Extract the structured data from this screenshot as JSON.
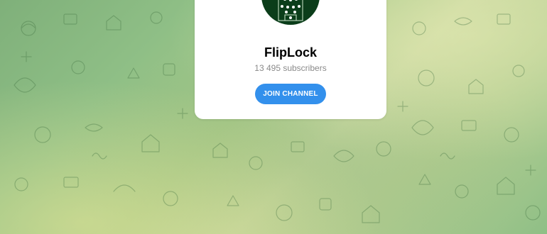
{
  "channel": {
    "name": "FlipLock",
    "subscribers": "13 495 subscribers",
    "join_label": "JOIN CHANNEL",
    "avatar_icon": "football-pitch-lineup-icon"
  },
  "colors": {
    "accent": "#3390ec",
    "avatar_bg": "#0b3d1a",
    "pattern_tint": "#5f8f5a"
  },
  "background": {
    "pattern_icon": "doodle-pattern-icon"
  }
}
